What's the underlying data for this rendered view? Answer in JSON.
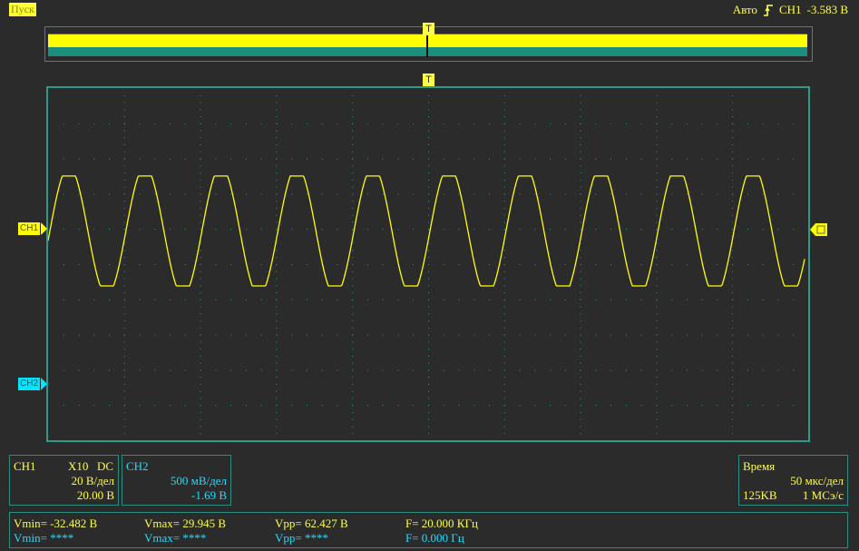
{
  "status": {
    "run_label": "Пуск",
    "trigger_mode": "Авто",
    "trigger_source": "CH1",
    "trigger_level": "-3.583 В"
  },
  "trigger_marker_label": "T",
  "markers": {
    "ch1": "CH1",
    "ch2": "CH2"
  },
  "ch1_panel": {
    "name": "CH1",
    "probe": "X10",
    "coupling": "DC",
    "scale": "20 В/дел",
    "offset": "20.00 В"
  },
  "ch2_panel": {
    "name": "CH2",
    "scale": "500 мВ/дел",
    "offset": "-1.69 В"
  },
  "time_panel": {
    "title": "Время",
    "scale": "50 мкс/дел",
    "memory": "125KB",
    "sample_rate": "1 МСэ/с"
  },
  "measurements": {
    "ch1": {
      "vmin": "Vmin= -32.482 В",
      "vmax": "Vmax= 29.945 В",
      "vpp": "Vpp= 62.427 В",
      "freq": "F= 20.000 КГц"
    },
    "ch2": {
      "vmin": "Vmin= ****",
      "vmax": "Vmax= ****",
      "vpp": "Vpp= ****",
      "freq": "F= 0.000 Гц"
    }
  },
  "colors": {
    "ch1": "#ffff00",
    "ch2": "#00e5ff",
    "grid": "#2a9b8a",
    "background": "#2b2b2b"
  }
}
